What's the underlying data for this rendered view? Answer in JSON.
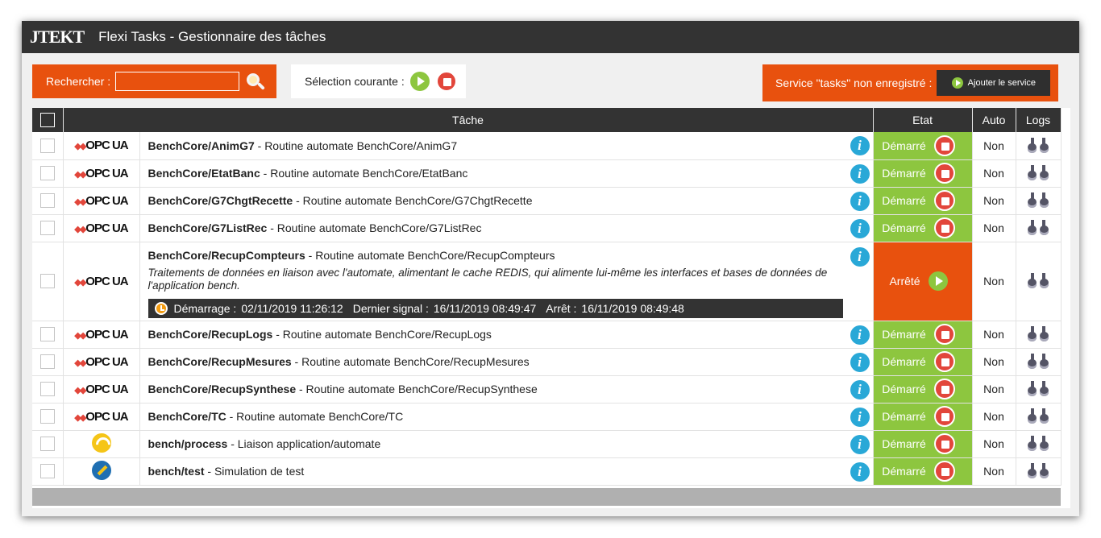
{
  "header": {
    "logo": "JTEKT",
    "title": "Flexi Tasks - Gestionnaire des tâches"
  },
  "search": {
    "label": "Rechercher :",
    "value": ""
  },
  "selection": {
    "label": "Sélection courante :"
  },
  "service": {
    "label": "Service \"tasks\" non enregistré :",
    "button": "Ajouter le service"
  },
  "columns": {
    "task": "Tâche",
    "state": "Etat",
    "auto": "Auto",
    "logs": "Logs"
  },
  "opc_label": "OPC UA",
  "colors": {
    "accent": "#e8510e",
    "running": "#8dc63f",
    "stop": "#e2463b",
    "header": "#333333",
    "info": "#29a8d7"
  },
  "rows": [
    {
      "icon": "opcua-logo",
      "name": "BenchCore/AnimG7",
      "desc": " - Routine automate BenchCore/AnimG7",
      "state": "Démarré",
      "auto": "Non"
    },
    {
      "icon": "opcua-logo",
      "name": "BenchCore/EtatBanc",
      "desc": " - Routine automate BenchCore/EtatBanc",
      "state": "Démarré",
      "auto": "Non"
    },
    {
      "icon": "opcua-logo",
      "name": "BenchCore/G7ChgtRecette",
      "desc": " - Routine automate BenchCore/G7ChgtRecette",
      "state": "Démarré",
      "auto": "Non"
    },
    {
      "icon": "opcua-logo",
      "name": "BenchCore/G7ListRec",
      "desc": " - Routine automate BenchCore/G7ListRec",
      "state": "Démarré",
      "auto": "Non"
    },
    {
      "icon": "opcua-logo",
      "name": "BenchCore/RecupCompteurs",
      "desc": " - Routine automate BenchCore/RecupCompteurs",
      "state": "Arrêté",
      "auto": "Non",
      "details": "Traitements de données en liaison avec l'automate, alimentant le cache REDIS, qui alimente lui-même les interfaces et bases de données de l'application bench.",
      "start_label": "Démarrage :",
      "start": "02/11/2019 11:26:12",
      "signal_label": "Dernier signal :",
      "signal": "16/11/2019 08:49:47",
      "stop_label": "Arrêt :",
      "stop": "16/11/2019 08:49:48"
    },
    {
      "icon": "opcua-logo",
      "name": "BenchCore/RecupLogs",
      "desc": " - Routine automate BenchCore/RecupLogs",
      "state": "Démarré",
      "auto": "Non"
    },
    {
      "icon": "opcua-logo",
      "name": "BenchCore/RecupMesures",
      "desc": " - Routine automate BenchCore/RecupMesures",
      "state": "Démarré",
      "auto": "Non"
    },
    {
      "icon": "opcua-logo",
      "name": "BenchCore/RecupSynthese",
      "desc": " - Routine automate BenchCore/RecupSynthese",
      "state": "Démarré",
      "auto": "Non"
    },
    {
      "icon": "opcua-logo",
      "name": "BenchCore/TC",
      "desc": " - Routine automate BenchCore/TC",
      "state": "Démarré",
      "auto": "Non"
    },
    {
      "icon": "wifi-icon",
      "name": "bench/process",
      "desc": " - Liaison application/automate",
      "state": "Démarré",
      "auto": "Non"
    },
    {
      "icon": "edit-icon",
      "name": "bench/test",
      "desc": " - Simulation de test",
      "state": "Démarré",
      "auto": "Non"
    }
  ]
}
